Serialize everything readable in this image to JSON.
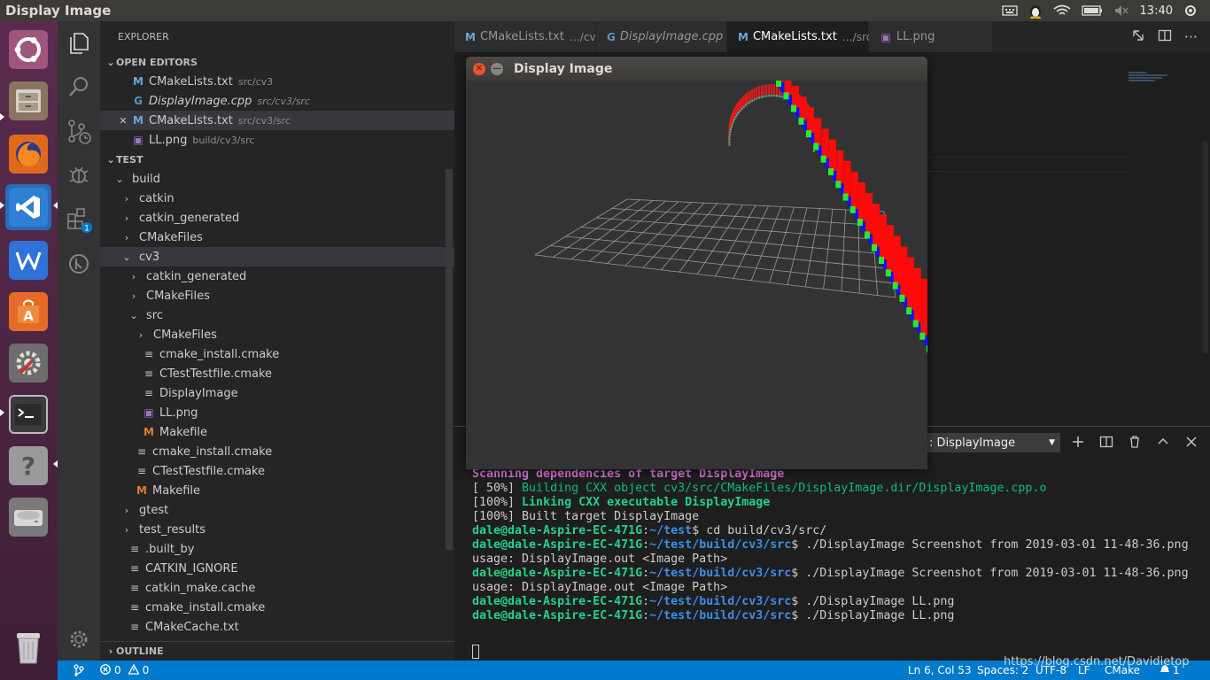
{
  "topbar": {
    "title": "Display Image",
    "time": "13:40"
  },
  "launcher": [
    "ubuntu-dash",
    "files",
    "firefox",
    "vscode",
    "wps-writer",
    "software-center",
    "settings",
    "terminal",
    "help",
    "disk",
    "trash"
  ],
  "sidebar": {
    "title": "EXPLORER",
    "open_editors_header": "OPEN EDITORS",
    "open_editors": [
      {
        "name": "CMakeLists.txt",
        "desc": "src/cv3",
        "icon": "M",
        "italic": false
      },
      {
        "name": "DisplayImage.cpp",
        "desc": "src/cv3/src",
        "icon": "C",
        "italic": true
      },
      {
        "name": "CMakeLists.txt",
        "desc": "src/cv3/src",
        "icon": "M",
        "italic": false
      },
      {
        "name": "LL.png",
        "desc": "build/cv3/src",
        "icon": "img",
        "italic": false
      }
    ],
    "workspace_header": "TEST",
    "tree": [
      {
        "name": "build",
        "depth": 0,
        "kind": "open"
      },
      {
        "name": "catkin",
        "depth": 1,
        "kind": "closed"
      },
      {
        "name": "catkin_generated",
        "depth": 1,
        "kind": "closed"
      },
      {
        "name": "CMakeFiles",
        "depth": 1,
        "kind": "closed"
      },
      {
        "name": "cv3",
        "depth": 1,
        "kind": "open"
      },
      {
        "name": "catkin_generated",
        "depth": 2,
        "kind": "closed"
      },
      {
        "name": "CMakeFiles",
        "depth": 2,
        "kind": "closed"
      },
      {
        "name": "src",
        "depth": 2,
        "kind": "open"
      },
      {
        "name": "CMakeFiles",
        "depth": 3,
        "kind": "closed"
      },
      {
        "name": "cmake_install.cmake",
        "depth": 3,
        "kind": "file"
      },
      {
        "name": "CTestTestfile.cmake",
        "depth": 3,
        "kind": "file"
      },
      {
        "name": "DisplayImage",
        "depth": 3,
        "kind": "file"
      },
      {
        "name": "LL.png",
        "depth": 3,
        "kind": "img"
      },
      {
        "name": "Makefile",
        "depth": 3,
        "kind": "make"
      },
      {
        "name": "cmake_install.cmake",
        "depth": 2,
        "kind": "file"
      },
      {
        "name": "CTestTestfile.cmake",
        "depth": 2,
        "kind": "file"
      },
      {
        "name": "Makefile",
        "depth": 2,
        "kind": "make"
      },
      {
        "name": "gtest",
        "depth": 1,
        "kind": "closed"
      },
      {
        "name": "test_results",
        "depth": 1,
        "kind": "closed"
      },
      {
        "name": ".built_by",
        "depth": 1,
        "kind": "file"
      },
      {
        "name": "CATKIN_IGNORE",
        "depth": 1,
        "kind": "file"
      },
      {
        "name": "catkin_make.cache",
        "depth": 1,
        "kind": "file"
      },
      {
        "name": "cmake_install.cmake",
        "depth": 1,
        "kind": "file"
      },
      {
        "name": "CMakeCache.txt",
        "depth": 1,
        "kind": "file"
      }
    ],
    "outline_header": "OUTLINE"
  },
  "tabs": [
    {
      "name": "CMakeLists.txt",
      "desc": "…/cv3",
      "icon": "M",
      "italic": false,
      "active": false
    },
    {
      "name": "DisplayImage.cpp",
      "desc": "",
      "icon": "C",
      "italic": true,
      "active": false
    },
    {
      "name": "CMakeLists.txt",
      "desc": "…/src",
      "icon": "M",
      "italic": false,
      "active": true
    },
    {
      "name": "LL.png",
      "desc": "",
      "icon": "img",
      "italic": false,
      "active": false
    }
  ],
  "panel": {
    "terminal_select": ": DisplayImage"
  },
  "terminal": [
    {
      "spans": [
        {
          "t": "####",
          "c": "b1"
        }
      ]
    },
    {
      "spans": [
        {
          "t": "Scanning dependencies of target DisplayImage",
          "c": "m1"
        }
      ]
    },
    {
      "spans": [
        {
          "t": "[ 50%] ",
          "c": ""
        },
        {
          "t": "Building CXX object cv3/src/CMakeFiles/DisplayImage.dir/DisplayImage.cpp.o",
          "c": "gr"
        }
      ]
    },
    {
      "spans": [
        {
          "t": "[100%] ",
          "c": ""
        },
        {
          "t": "Linking CXX executable DisplayImage",
          "c": "g1"
        }
      ]
    },
    {
      "spans": [
        {
          "t": "[100%] Built target DisplayImage",
          "c": ""
        }
      ]
    },
    {
      "spans": [
        {
          "t": "dale@dale-Aspire-EC-471G",
          "c": "g1"
        },
        {
          "t": ":",
          "c": ""
        },
        {
          "t": "~/test",
          "c": "b1"
        },
        {
          "t": "$ cd build/cv3/src/",
          "c": ""
        }
      ]
    },
    {
      "spans": [
        {
          "t": "dale@dale-Aspire-EC-471G",
          "c": "g1"
        },
        {
          "t": ":",
          "c": ""
        },
        {
          "t": "~/test/build/cv3/src",
          "c": "b1"
        },
        {
          "t": "$ ./DisplayImage Screenshot from 2019-03-01 11-48-36.png",
          "c": ""
        }
      ]
    },
    {
      "spans": [
        {
          "t": "usage: DisplayImage.out <Image Path>",
          "c": ""
        }
      ]
    },
    {
      "spans": [
        {
          "t": "dale@dale-Aspire-EC-471G",
          "c": "g1"
        },
        {
          "t": ":",
          "c": ""
        },
        {
          "t": "~/test/build/cv3/src",
          "c": "b1"
        },
        {
          "t": "$ ./DisplayImage Screenshot from 2019-03-01 11-48-36.png",
          "c": ""
        }
      ]
    },
    {
      "spans": [
        {
          "t": "usage: DisplayImage.out <Image Path>",
          "c": ""
        }
      ]
    },
    {
      "spans": [
        {
          "t": "dale@dale-Aspire-EC-471G",
          "c": "g1"
        },
        {
          "t": ":",
          "c": ""
        },
        {
          "t": "~/test/build/cv3/src",
          "c": "b1"
        },
        {
          "t": "$ ./DisplayImage LL.png",
          "c": ""
        }
      ]
    },
    {
      "spans": [
        {
          "t": "dale@dale-Aspire-EC-471G",
          "c": "g1"
        },
        {
          "t": ":",
          "c": ""
        },
        {
          "t": "~/test/build/cv3/src",
          "c": "b1"
        },
        {
          "t": "$ ./DisplayImage LL.png",
          "c": ""
        }
      ]
    }
  ],
  "status": {
    "errors": "0",
    "warnings": "0",
    "position": "Ln 6, Col 53",
    "spaces": "Spaces: 2",
    "encoding": "UTF-8",
    "eol": "LF",
    "language": "CMake",
    "watermark": "https://blog.csdn.net/Davidietop",
    "notifications": "1"
  },
  "dialog": {
    "title": "Display Image"
  },
  "colors": {
    "accent": "#007acc",
    "launcher": "#5a2b4e"
  }
}
